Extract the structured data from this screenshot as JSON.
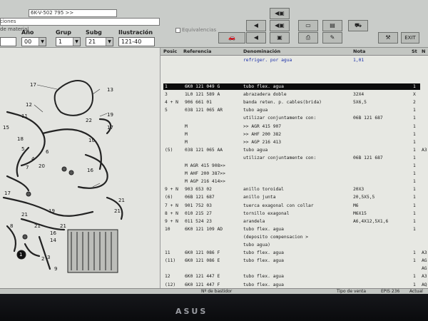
{
  "header": {
    "field_top_value": "6K-V-502 795 >>",
    "left_label_1": "ciones",
    "left_label_2": "de material",
    "checkbox_label": "Equivalencias",
    "labels": {
      "ano": "Año",
      "grup": "Grup",
      "subg": "Subg",
      "ilustracion": "Ilustración"
    },
    "values": {
      "ano": "00",
      "grup": "1",
      "subg": "21",
      "ilustracion": "121-40"
    },
    "exit_label": "EXIT"
  },
  "table": {
    "headers": {
      "posic": "Posic",
      "referencia": "Referencia",
      "denominacion": "Denominación",
      "nota": "Nota",
      "st": "St",
      "n": "N"
    },
    "subtitle": "refriger. por agua",
    "subtitle_nota": "1,01",
    "rows": [
      {
        "pos": "1",
        "ref": "6K0 121 049 G",
        "den": "tubo flex. agua",
        "nota": "",
        "st": "1",
        "n": "",
        "selected": true
      },
      {
        "pos": "3",
        "ref": "1L0 121 589 A",
        "den": "abrazadera doble",
        "nota": "32X4",
        "st": "X",
        "n": ""
      },
      {
        "pos": "4 + N",
        "ref": "906 661 01",
        "den": "banda reten. p. cables(brida)",
        "nota": "5X6,5",
        "st": "2",
        "n": ""
      },
      {
        "pos": "5",
        "ref": "038 121 065 AR",
        "den": "tubo agua",
        "nota": "",
        "st": "1",
        "n": ""
      },
      {
        "pos": "",
        "ref": "",
        "den": "utilizar conjuntamente con:",
        "nota": "06B 121 687",
        "st": "1",
        "n": ""
      },
      {
        "pos": "",
        "ref": "M",
        "den": ">> AGR  415 907",
        "nota": "",
        "st": "1",
        "n": ""
      },
      {
        "pos": "",
        "ref": "M",
        "den": ">> AHF  200 382",
        "nota": "",
        "st": "1",
        "n": ""
      },
      {
        "pos": "",
        "ref": "M",
        "den": ">> AGP  216 413",
        "nota": "",
        "st": "1",
        "n": ""
      },
      {
        "pos": "(5)",
        "ref": "038 121 065 AA",
        "den": "tubo agua",
        "nota": "",
        "st": "1",
        "n": "A3"
      },
      {
        "pos": "",
        "ref": "",
        "den": "utilizar conjuntamente con:",
        "nota": "06B 121 687",
        "st": "1",
        "n": ""
      },
      {
        "pos": "",
        "ref": "M AGR  415 908>>",
        "den": "",
        "nota": "",
        "st": "1",
        "n": ""
      },
      {
        "pos": "",
        "ref": "M AHF  200 387>>",
        "den": "",
        "nota": "",
        "st": "1",
        "n": ""
      },
      {
        "pos": "",
        "ref": "M AGP  216 414>>",
        "den": "",
        "nota": "",
        "st": "1",
        "n": ""
      },
      {
        "pos": "9 + N",
        "ref": "903 653 02",
        "den": "anillo toroidal",
        "nota": "20X3",
        "st": "1",
        "n": ""
      },
      {
        "pos": "(6)",
        "ref": "06B 121 687",
        "den": "anillo junta",
        "nota": "20,5X5,5",
        "st": "1",
        "n": ""
      },
      {
        "pos": "7 + N",
        "ref": "901 752 03",
        "den": "tuerca exagonal con collar",
        "nota": "M6",
        "st": "1",
        "n": ""
      },
      {
        "pos": "8 + N",
        "ref": "010 215 27",
        "den": "tornillo exagonal",
        "nota": "M6X15",
        "st": "1",
        "n": ""
      },
      {
        "pos": "9 + N",
        "ref": "011 524 23",
        "den": "arandela",
        "nota": "A6,4X12,5X1,6",
        "st": "1",
        "n": ""
      },
      {
        "pos": "10",
        "ref": "6K0 121 109 AD",
        "den": "tubo flex. agua",
        "nota": "",
        "st": "1",
        "n": ""
      },
      {
        "pos": "",
        "ref": "",
        "den": "(deposito compensacion >",
        "nota": "",
        "st": "",
        "n": ""
      },
      {
        "pos": "",
        "ref": "",
        "den": "tubo agua)",
        "nota": "",
        "st": "",
        "n": ""
      },
      {
        "pos": "11",
        "ref": "6K0 121 086 F",
        "den": "tubo flex. agua",
        "nota": "",
        "st": "1",
        "n": "A3"
      },
      {
        "pos": "(11)",
        "ref": "6K0 121 086 E",
        "den": "tubo flex. agua",
        "nota": "",
        "st": "1",
        "n": "AG"
      },
      {
        "pos": "",
        "ref": "",
        "den": "",
        "nota": "",
        "st": "",
        "n": "AG"
      },
      {
        "pos": "12",
        "ref": "6K0 121 447 E",
        "den": "tubo flex. agua",
        "nota": "",
        "st": "1",
        "n": "A3"
      },
      {
        "pos": "(12)",
        "ref": "6K0 121 447 F",
        "den": "tubo flex. agua",
        "nota": "",
        "st": "1",
        "n": "AQ"
      }
    ]
  },
  "diagram": {
    "callouts": [
      "17",
      "13",
      "12",
      "11",
      "22",
      "19",
      "15",
      "18",
      "5",
      "6",
      "4",
      "7",
      "20",
      "10",
      "16",
      "17",
      "21",
      "21",
      "19",
      "8",
      "21",
      "21",
      "16",
      "14",
      "1",
      "3",
      "9",
      "2",
      "17",
      "21"
    ]
  },
  "status": {
    "bastidor": "Nº de bastidor",
    "tipo_venta": "Tipo de venta",
    "version": "EPIS 236",
    "actual": "Actual"
  },
  "monitor_brand": "ASUS"
}
